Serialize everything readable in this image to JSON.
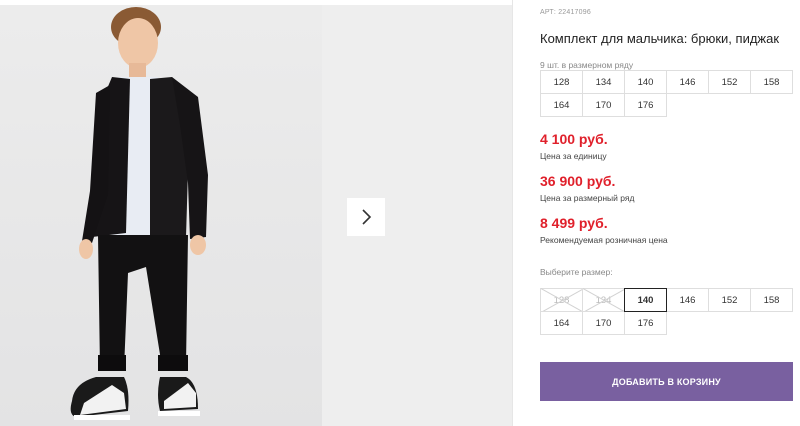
{
  "product": {
    "article": "АРТ: 22417096",
    "title": "Комплект для мальчика: брюки, пиджак"
  },
  "set_sizes": {
    "label": "9 шт. в размерном ряду",
    "rows": [
      [
        "128",
        "134",
        "140",
        "146",
        "152",
        "158"
      ],
      [
        "164",
        "170",
        "176"
      ]
    ]
  },
  "prices": {
    "unit_price": "4 100 руб.",
    "unit_label": "Цена за единицу",
    "set_price": "36 900 руб.",
    "set_label": "Цена за размерный ряд",
    "retail_price": "8 499 руб.",
    "retail_label": "Рекомендуемая розничная цена"
  },
  "size_picker": {
    "label": "Выберите размер:",
    "rows": [
      [
        "128",
        "134",
        "140",
        "146",
        "152",
        "158"
      ],
      [
        "164",
        "170",
        "176"
      ]
    ],
    "unavailable": [
      "128",
      "134"
    ],
    "selected": "140"
  },
  "cart_button": "ДОБАВИТЬ В КОРЗИНУ",
  "colors": {
    "price": "#e0202b",
    "button": "#7960a0"
  },
  "icons": {
    "gallery_next": "chevron-right-icon"
  }
}
